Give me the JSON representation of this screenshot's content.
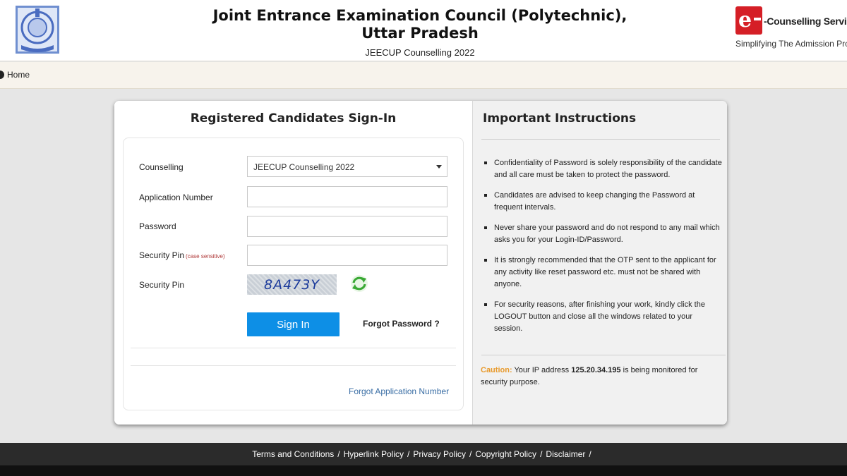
{
  "header": {
    "title": "Joint Entrance Examination Council (Polytechnic), Uttar Pradesh",
    "subtitle": "JEECUP Counselling 2022",
    "brand_letter": "e",
    "brand_name": "-Counselling Services",
    "brand_tagline": "Simplifying The Admission Process"
  },
  "nav": {
    "home_label": "Home"
  },
  "signin": {
    "title": "Registered Candidates Sign-In",
    "counselling_label": "Counselling",
    "counselling_value": "JEECUP Counselling 2022",
    "application_label": "Application Number",
    "application_value": "",
    "password_label": "Password",
    "password_value": "",
    "security_pin_label": "Security Pin",
    "security_pin_note": "(case sensitive)",
    "security_pin_value": "",
    "captcha_label": "Security Pin",
    "captcha_text": "8A473Y",
    "signin_button": "Sign In",
    "forgot_password": "Forgot Password ?",
    "forgot_application": "Forgot Application Number"
  },
  "instructions": {
    "title": "Important Instructions",
    "items": [
      "Confidentiality of Password is solely responsibility of the candidate and all care must be taken to protect the password.",
      "Candidates are advised to keep changing the Password at frequent intervals.",
      "Never share your password and do not respond to any mail which asks you for your Login-ID/Password.",
      "It is strongly recommended that the OTP sent to the applicant for any activity like reset password etc. must not be shared with anyone.",
      "For security reasons, after finishing your work, kindly click the LOGOUT button and close all the windows related to your session."
    ],
    "caution_label": "Caution:",
    "caution_pre": " Your IP address ",
    "caution_ip": "125.20.34.195",
    "caution_post": " is being monitored for security purpose."
  },
  "footer": {
    "links": [
      "Terms and Conditions",
      "Hyperlink Policy",
      "Privacy Policy",
      "Copyright Policy",
      "Disclaimer"
    ],
    "separator": "/"
  },
  "colors": {
    "signin_button": "#0d8fe6",
    "caution_label": "#e89a2c",
    "brand_red": "#d51f26",
    "footer_bg": "#2b2b2b"
  }
}
